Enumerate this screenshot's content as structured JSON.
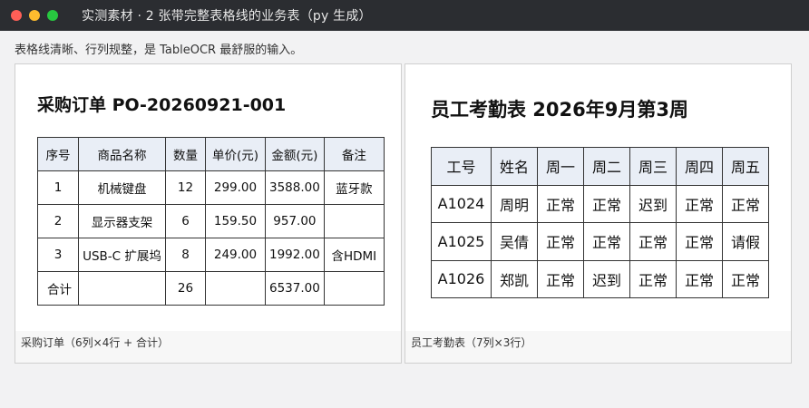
{
  "window": {
    "title": "实测素材 · 2 张带完整表格线的业务表（py 生成）"
  },
  "intro_text": "表格线清晰、行列规整，是 TableOCR 最舒服的输入。",
  "cards": [
    {
      "doc_title": "采购订单 PO-20260921-001",
      "caption": "采购订单（6列×4行 + 合计）",
      "headers": [
        "序号",
        "商品名称",
        "数量",
        "单价(元)",
        "金额(元)",
        "备注"
      ],
      "rows": [
        [
          "1",
          "机械键盘",
          "12",
          "299.00",
          "3588.00",
          "蓝牙款"
        ],
        [
          "2",
          "显示器支架",
          "6",
          "159.50",
          "957.00",
          ""
        ],
        [
          "3",
          "USB-C 扩展坞",
          "8",
          "249.00",
          "1992.00",
          "含HDMI"
        ],
        [
          "合计",
          "",
          "26",
          "",
          "6537.00",
          ""
        ]
      ]
    },
    {
      "doc_title": "员工考勤表 2026年9月第3周",
      "caption": "员工考勤表（7列×3行）",
      "headers": [
        "工号",
        "姓名",
        "周一",
        "周二",
        "周三",
        "周四",
        "周五"
      ],
      "rows": [
        [
          "A1024",
          "周明",
          "正常",
          "正常",
          "迟到",
          "正常",
          "正常"
        ],
        [
          "A1025",
          "吴倩",
          "正常",
          "正常",
          "正常",
          "正常",
          "请假"
        ],
        [
          "A1026",
          "郑凯",
          "正常",
          "迟到",
          "正常",
          "正常",
          "正常"
        ]
      ]
    }
  ],
  "colors": {
    "titlebar": "#2b2d31",
    "header_fill": "#e9eef6",
    "close": "#ff5f57",
    "minimize": "#febc2e",
    "maximize": "#28c840"
  }
}
